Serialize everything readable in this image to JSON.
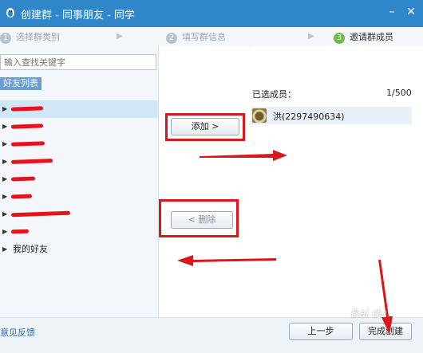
{
  "window": {
    "title": "创建群 - 同事朋友 - 同学",
    "minimize_label": "–",
    "close_label": "✕"
  },
  "steps": [
    {
      "num": "1",
      "label": "选择群类别"
    },
    {
      "num": "2",
      "label": "填写群信息"
    },
    {
      "num": "3",
      "label": "邀请群成员"
    }
  ],
  "search": {
    "placeholder": "输入查找关键字"
  },
  "friends": {
    "tag": "好友列表",
    "groups": [
      {
        "label": "",
        "redacted": true
      },
      {
        "label": "",
        "redacted": true
      },
      {
        "label": "",
        "redacted": true
      },
      {
        "label": "",
        "redacted": true
      },
      {
        "label": "",
        "redacted": true
      },
      {
        "label": "",
        "redacted": true
      },
      {
        "label": "",
        "redacted": true
      },
      {
        "label": "",
        "redacted": true
      },
      {
        "label": "我的好友",
        "redacted": false
      }
    ]
  },
  "actions": {
    "add_label": "添加 >",
    "remove_label": "< 删除"
  },
  "selected": {
    "label": "已选成员：",
    "count": "1/500",
    "members": [
      {
        "name": "洪(2297490634)",
        "avatar": "avatar-icon"
      }
    ]
  },
  "footer": {
    "feedback_label": "意见反馈",
    "prev_label": "上一步",
    "finish_label": "完成创建"
  },
  "colors": {
    "titlebar": "#2f87c9",
    "annotation": "#d9171d",
    "active_step": "#6fb94a"
  }
}
